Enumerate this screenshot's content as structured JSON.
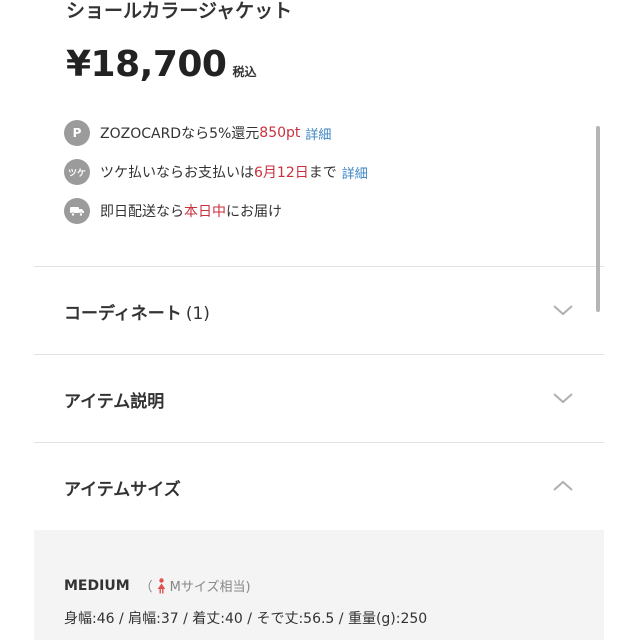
{
  "product": {
    "title": "ショールカラージャケット",
    "price": "¥18,700",
    "tax_label": "税込"
  },
  "benefits": [
    {
      "icon": "p-icon",
      "icon_text": "P",
      "text1": "ZOZOCARDなら5%還元 ",
      "highlight": "850pt",
      "text2": "",
      "link": "詳細"
    },
    {
      "icon": "tsuke-icon",
      "icon_text": "ツケ",
      "text1": "ツケ払いならお支払いは",
      "highlight": "6月12日",
      "text2": "まで",
      "link": "詳細"
    },
    {
      "icon": "truck-icon",
      "icon_text": "",
      "text1": "即日配送なら",
      "highlight": "本日中",
      "text2": "にお届け",
      "link": ""
    }
  ],
  "sections": [
    {
      "label": "コーディネート",
      "count": "(1)",
      "expanded": false
    },
    {
      "label": "アイテム説明",
      "count": "",
      "expanded": false
    },
    {
      "label": "アイテムサイズ",
      "count": "",
      "expanded": true
    }
  ],
  "size": {
    "name": "MEDIUM",
    "note_open": "（",
    "note_text": "Mサイズ相当)",
    "detail": "身幅:46 / 肩幅:37 / 着丈:40 / そで丈:56.5 / 重量(g):250"
  },
  "colors": {
    "accent_red": "#c8313d",
    "link_blue": "#3a84c4",
    "icon_gray": "#9b9b9b",
    "panel_bg": "#f4f4f4"
  }
}
